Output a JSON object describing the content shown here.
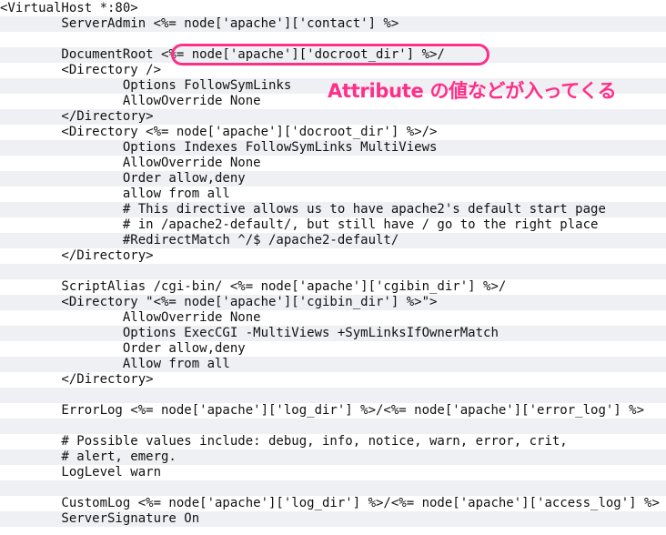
{
  "code": {
    "lines": [
      "<VirtualHost *:80>",
      "        ServerAdmin <%= node['apache']['contact'] %>",
      "",
      "        DocumentRoot <%= node['apache']['docroot_dir'] %>/",
      "        <Directory />",
      "                Options FollowSymLinks",
      "                AllowOverride None",
      "        </Directory>",
      "        <Directory <%= node['apache']['docroot_dir'] %>/>",
      "                Options Indexes FollowSymLinks MultiViews",
      "                AllowOverride None",
      "                Order allow,deny",
      "                allow from all",
      "                # This directive allows us to have apache2's default start page",
      "                # in /apache2-default/, but still have / go to the right place",
      "                #RedirectMatch ^/$ /apache2-default/",
      "        </Directory>",
      "",
      "        ScriptAlias /cgi-bin/ <%= node['apache']['cgibin_dir'] %>/",
      "        <Directory \"<%= node['apache']['cgibin_dir'] %>\">",
      "                AllowOverride None",
      "                Options ExecCGI -MultiViews +SymLinksIfOwnerMatch",
      "                Order allow,deny",
      "                Allow from all",
      "        </Directory>",
      "",
      "        ErrorLog <%= node['apache']['log_dir'] %>/<%= node['apache']['error_log'] %>",
      "",
      "        # Possible values include: debug, info, notice, warn, error, crit,",
      "        # alert, emerg.",
      "        LogLevel warn",
      "",
      "        CustomLog <%= node['apache']['log_dir'] %>/<%= node['apache']['access_log'] %>",
      "        ServerSignature On"
    ]
  },
  "annotation": {
    "text": "Attribute の値などが入ってくる"
  },
  "colors": {
    "highlight": "#ff2e88",
    "stripe": "#eef0f3",
    "text": "#111111"
  }
}
